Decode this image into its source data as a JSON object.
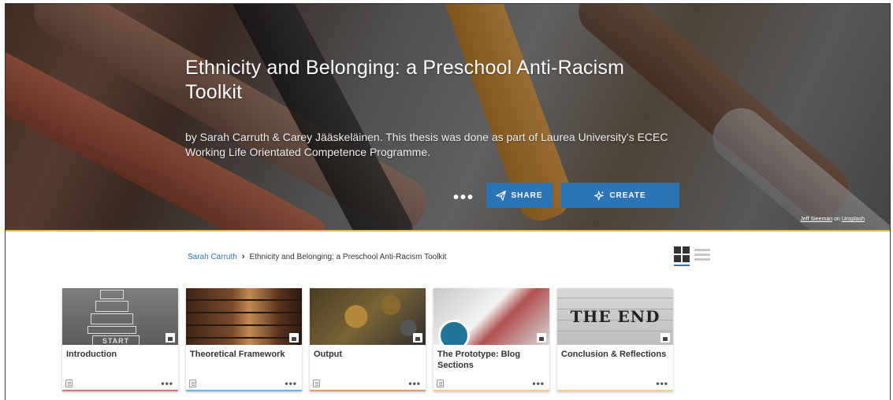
{
  "hero": {
    "title": "Ethnicity and Belonging: a Preschool Anti-Racism Toolkit",
    "subtitle": "by Sarah Carruth & Carey Jääskeläinen. This thesis was done as part of Laurea University's ECEC Working Life Orientated Competence Programme.",
    "more_label": "•••",
    "share_label": "SHARE",
    "create_label": "CREATE",
    "credit_author": "Jeff Sieeman",
    "credit_on": "on",
    "credit_source": "Unsplash"
  },
  "breadcrumb": {
    "root": "Sarah Carruth",
    "separator": "›",
    "current": "Ethnicity and Belonging: a Preschool Anti-Racism Toolkit"
  },
  "cards": [
    {
      "title": "Introduction",
      "bar_color": "#e57373",
      "image": "hopscotch",
      "image_text": "START"
    },
    {
      "title": "Theoretical Framework",
      "bar_color": "#64b5f6",
      "image": "library"
    },
    {
      "title": "Output",
      "bar_color": "#ef9a66",
      "image": "gears"
    },
    {
      "title": "The Prototype: Blog Sections",
      "bar_color": "#ffcc80",
      "image": "wordpress"
    },
    {
      "title": "Conclusion & Reflections",
      "bar_color": "#ffcc80",
      "image": "the-end",
      "image_text": "THE END"
    }
  ],
  "card_more_label": "•••",
  "colors": {
    "accent": "#2c74b8",
    "hero_line": "#e8b064"
  }
}
